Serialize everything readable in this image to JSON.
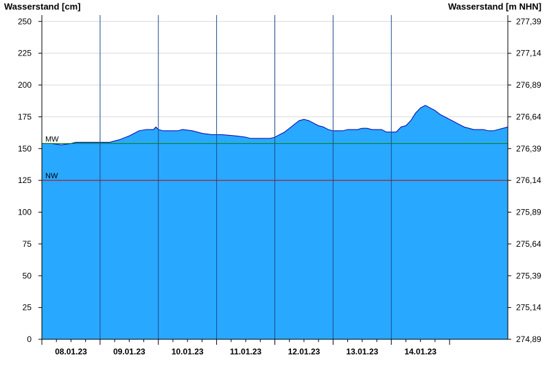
{
  "chart_data": {
    "type": "area",
    "ylabel_left": "Wasserstand [cm]",
    "ylabel_right": "Wasserstand [m NHN]",
    "ylim": [
      0,
      255
    ],
    "yticks_left": [
      0,
      25,
      50,
      75,
      100,
      125,
      150,
      175,
      200,
      225,
      250
    ],
    "yticks_right": [
      "274,89",
      "275,14",
      "275,39",
      "275,64",
      "275,89",
      "276,14",
      "276,39",
      "276,64",
      "276,89",
      "277,14",
      "277,39"
    ],
    "xlim_hours": [
      0,
      168
    ],
    "x_day_labels": [
      "08.01.23",
      "09.01.23",
      "10.01.23",
      "11.01.23",
      "12.01.23",
      "13.01.23",
      "14.01.23"
    ],
    "grid": true,
    "reference_lines": [
      {
        "label": "MW",
        "value": 154,
        "color": "#008000"
      },
      {
        "label": "NW",
        "value": 125,
        "color": "#c00000"
      }
    ],
    "series": [
      {
        "fill": "#29a8ff",
        "stroke": "#0000aa",
        "points": [
          [
            0,
            154
          ],
          [
            4,
            154
          ],
          [
            8,
            153
          ],
          [
            12,
            154
          ],
          [
            14,
            155
          ],
          [
            24,
            155
          ],
          [
            28,
            155
          ],
          [
            32,
            157
          ],
          [
            36,
            160
          ],
          [
            38,
            162
          ],
          [
            40,
            164
          ],
          [
            43,
            165
          ],
          [
            46,
            165
          ],
          [
            47,
            167
          ],
          [
            48,
            165
          ],
          [
            50,
            164
          ],
          [
            56,
            164
          ],
          [
            58,
            165
          ],
          [
            62,
            164
          ],
          [
            64,
            163
          ],
          [
            66,
            162
          ],
          [
            70,
            161
          ],
          [
            74,
            161
          ],
          [
            80,
            160
          ],
          [
            84,
            159
          ],
          [
            86,
            158
          ],
          [
            92,
            158
          ],
          [
            94,
            158
          ],
          [
            96,
            159
          ],
          [
            98,
            161
          ],
          [
            100,
            163
          ],
          [
            102,
            166
          ],
          [
            104,
            169
          ],
          [
            106,
            172
          ],
          [
            108,
            173
          ],
          [
            110,
            172
          ],
          [
            112,
            170
          ],
          [
            114,
            168
          ],
          [
            116,
            167
          ],
          [
            118,
            165
          ],
          [
            120,
            164
          ],
          [
            124,
            164
          ],
          [
            126,
            165
          ],
          [
            130,
            165
          ],
          [
            132,
            166
          ],
          [
            134,
            166
          ],
          [
            136,
            165
          ],
          [
            140,
            165
          ],
          [
            142,
            163
          ],
          [
            146,
            163
          ],
          [
            148,
            167
          ],
          [
            150,
            168
          ],
          [
            152,
            172
          ],
          [
            154,
            178
          ],
          [
            156,
            182
          ],
          [
            158,
            184
          ],
          [
            160,
            182
          ],
          [
            162,
            180
          ],
          [
            164,
            177
          ],
          [
            166,
            175
          ],
          [
            168,
            173
          ],
          [
            170,
            171
          ],
          [
            172,
            169
          ],
          [
            174,
            167
          ],
          [
            176,
            166
          ],
          [
            178,
            165
          ],
          [
            182,
            165
          ],
          [
            184,
            164
          ],
          [
            186,
            164
          ],
          [
            188,
            165
          ],
          [
            190,
            166
          ],
          [
            192,
            167
          ],
          [
            192,
            168
          ]
        ]
      }
    ]
  }
}
